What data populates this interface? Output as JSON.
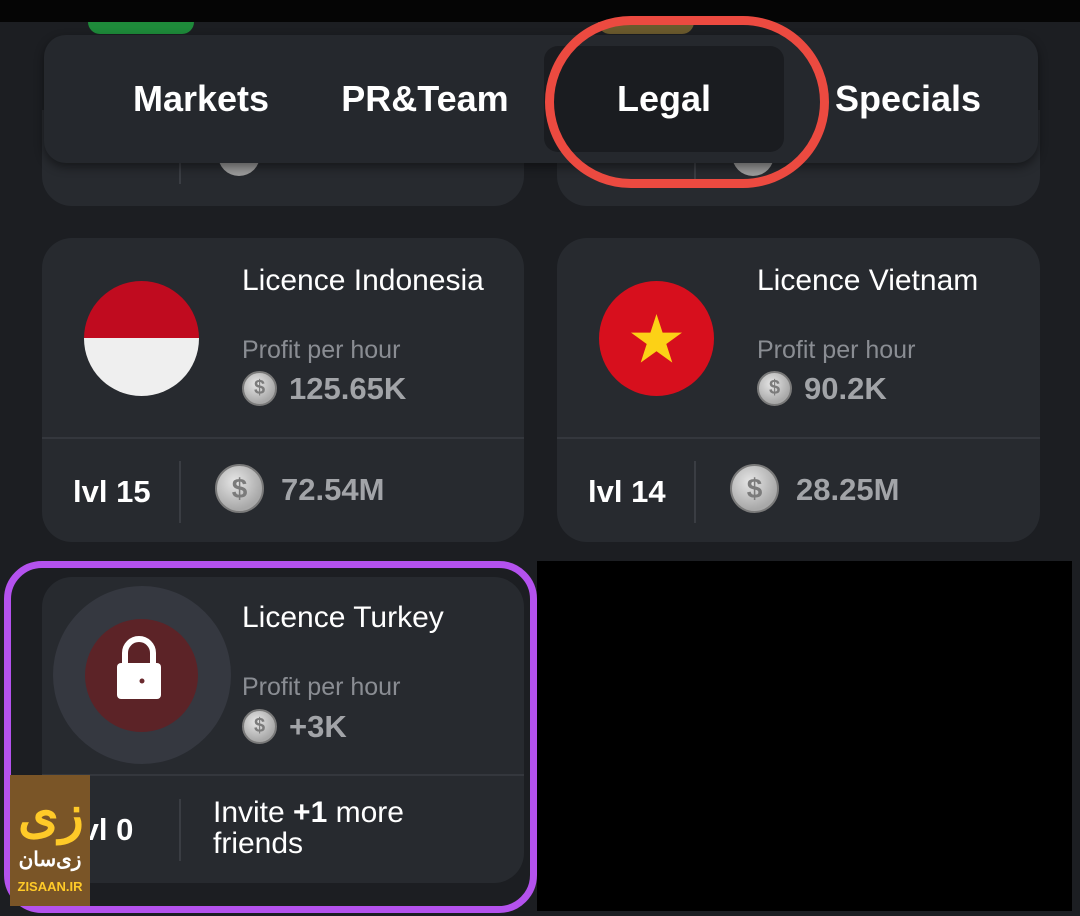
{
  "tabs": {
    "items": [
      {
        "label": "Markets",
        "active": false
      },
      {
        "label": "PR&Team",
        "active": false
      },
      {
        "label": "Legal",
        "active": true
      },
      {
        "label": "Specials",
        "active": false
      }
    ]
  },
  "cards": [
    {
      "title": "Licence Indonesia",
      "profit_label": "Profit per hour",
      "profit": "125.65K",
      "level": "lvl 15",
      "price": "72.54M",
      "flag": "indonesia-flag-icon"
    },
    {
      "title": "Licence Vietnam",
      "profit_label": "Profit per hour",
      "profit": "90.2K",
      "level": "lvl 14",
      "price": "28.25M",
      "flag": "vietnam-flag-icon"
    },
    {
      "title": "Licence Turkey",
      "profit_label": "Profit per hour",
      "profit": "+3K",
      "level": "lvl 0",
      "requirement_prefix": "Invite ",
      "requirement_bold": "+1",
      "requirement_suffix": " more",
      "requirement_line2": "friends",
      "locked": true,
      "flag": "turkey-flag-icon"
    }
  ],
  "coin_symbol": "$",
  "watermark": {
    "mark": "زی",
    "name_fa": "زی‌سان",
    "name_en": "ZISAAN.IR"
  },
  "colors": {
    "background": "#1c1e22",
    "card": "#272a2f",
    "highlight_red": "#ec4a40",
    "highlight_purple": "#b452ee"
  }
}
